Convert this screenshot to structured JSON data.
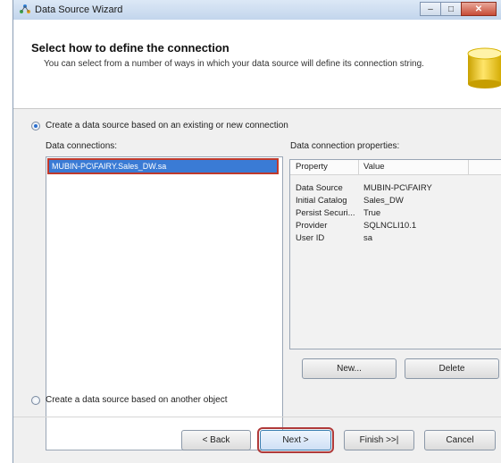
{
  "window": {
    "title": "Data Source Wizard"
  },
  "header": {
    "title": "Select how to define the connection",
    "description": "You can select from a number of ways in which your data source will define its connection string."
  },
  "options": {
    "existing": {
      "label": "Create a data source based on an existing or new connection",
      "checked": true
    },
    "other": {
      "label": "Create a data source based on another object",
      "checked": false
    }
  },
  "connections": {
    "label": "Data connections:",
    "items": [
      "MUBIN-PC\\FAIRY.Sales_DW.sa"
    ]
  },
  "properties": {
    "label": "Data connection properties:",
    "columns": [
      "Property",
      "Value"
    ],
    "rows": [
      {
        "property": "Data Source",
        "value": "MUBIN-PC\\FAIRY"
      },
      {
        "property": "Initial Catalog",
        "value": "Sales_DW"
      },
      {
        "property": "Persist Securi...",
        "value": "True"
      },
      {
        "property": "Provider",
        "value": "SQLNCLI10.1"
      },
      {
        "property": "User ID",
        "value": "sa"
      }
    ]
  },
  "buttons": {
    "new": "New...",
    "delete": "Delete",
    "back": "< Back",
    "next": "Next >",
    "finish": "Finish >>|",
    "cancel": "Cancel"
  },
  "colors": {
    "selection": "#3a7bd5",
    "highlight_outline": "#c0392b"
  },
  "icons": {
    "app": "wizard-icon",
    "header": "database-icon"
  }
}
